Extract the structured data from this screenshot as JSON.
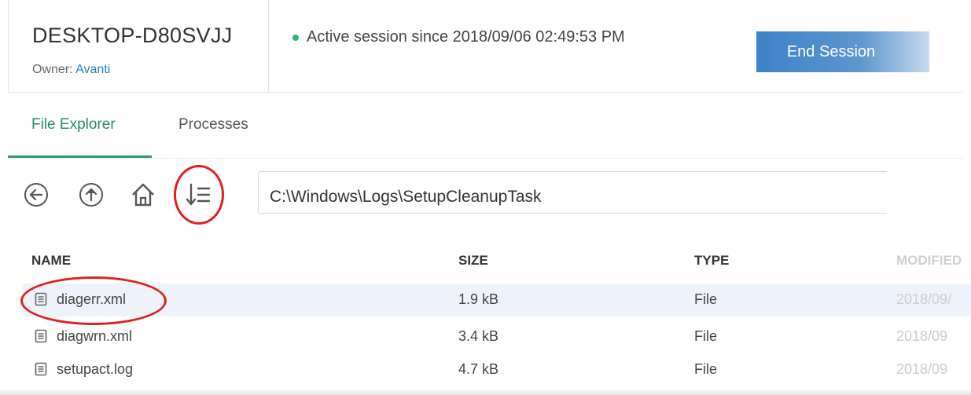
{
  "device": {
    "name": "DESKTOP-D80SVJJ",
    "owner_label": "Owner:",
    "owner_name": "Avanti"
  },
  "session": {
    "status_text": "Active session since 2018/09/06 02:49:53 PM",
    "end_button_label": "End Session",
    "status_color": "#2bb673"
  },
  "tabs": [
    {
      "label": "File Explorer",
      "active": true
    },
    {
      "label": "Processes",
      "active": false
    }
  ],
  "toolbar": {
    "icons": [
      "back-icon",
      "up-directory-icon",
      "home-icon",
      "sort-icon"
    ]
  },
  "path_bar": {
    "value": "C:\\Windows\\Logs\\SetupCleanupTask"
  },
  "table": {
    "headers": [
      "NAME",
      "SIZE",
      "TYPE",
      "MODIFIED"
    ],
    "rows": [
      {
        "name": "diagerr.xml",
        "size": "1.9 kB",
        "type": "File",
        "modified": "2018/09/"
      },
      {
        "name": "diagwrn.xml",
        "size": "3.4 kB",
        "type": "File",
        "modified": "2018/09"
      },
      {
        "name": "setupact.log",
        "size": "4.7 kB",
        "type": "File",
        "modified": "2018/09"
      }
    ]
  },
  "colors": {
    "accent_green": "#2a9a6b",
    "button_blue": "#3f82c7",
    "highlight_red": "#e02020",
    "selected_row": "#eef3fb"
  }
}
